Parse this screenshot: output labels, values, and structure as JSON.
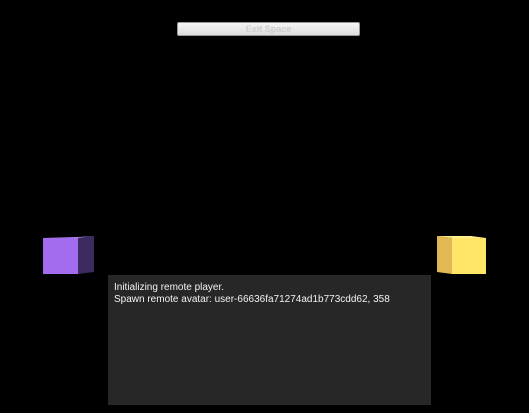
{
  "toolbar": {
    "exit_label": "Exit Space"
  },
  "scene": {
    "cube_left_color": "#a36cee",
    "cube_left_side_color": "#3b2b5e",
    "cube_left_top_color": "#b98af3",
    "cube_right_color": "#ffe666",
    "cube_right_side_color": "#e2b855",
    "cube_right_top_color": "#fff08c"
  },
  "console": {
    "lines": [
      "Initializing remote player.",
      "Spawn remote avatar: user-66636fa71274ad1b773cdd62, 358"
    ]
  }
}
